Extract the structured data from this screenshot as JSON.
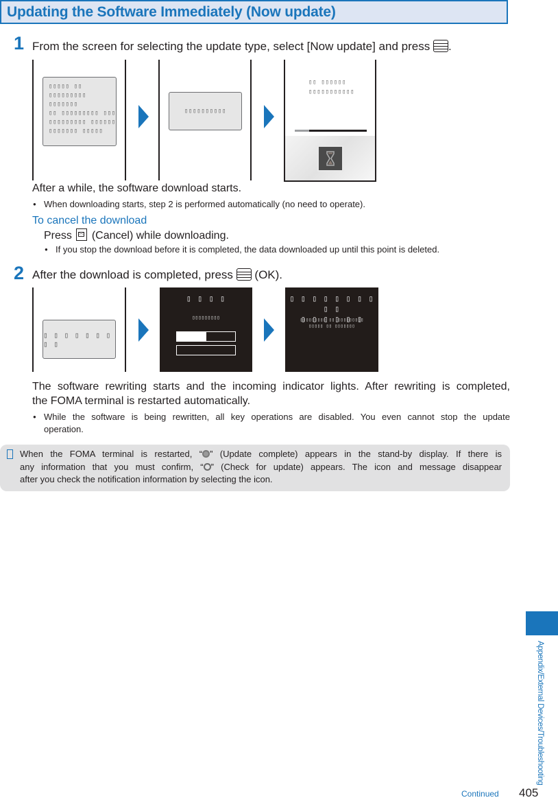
{
  "header": {
    "title": "Updating the Software Immediately (Now update)"
  },
  "step1": {
    "number": "1",
    "text_before": "From the screen for selecting the update type, select [Now update] and press",
    "text_after": ".",
    "key_icon": "menu-key-icon",
    "screens": [
      {
        "type": "dialog",
        "lines": [
          "▯▯▯▯▯ ▯▯",
          "▯▯▯▯▯▯▯▯▯",
          "▯▯▯▯▯▯▯",
          "▯▯ ▯▯▯▯▯▯▯▯▯ ▯▯▯",
          "▯▯▯▯▯▯▯▯▯ ▯▯▯▯▯▯",
          "▯▯▯▯▯▯▯ ▯▯▯▯▯"
        ]
      },
      {
        "type": "dialog",
        "lines": [
          "▯▯▯▯▯▯▯▯▯▯"
        ]
      },
      {
        "type": "download",
        "lines": [
          "▯▯ ▯▯▯▯▯▯",
          "▯▯▯▯▯▯▯▯▯▯▯"
        ],
        "progress": 0.2,
        "icon": "hourglass-icon"
      }
    ],
    "result": "After a while, the software download starts.",
    "bullet": "When downloading starts, step 2 is performed automatically (no need to operate).",
    "cancel": {
      "heading": "To cancel the download",
      "press_before": "Press",
      "press_after": "(Cancel) while downloading.",
      "key_icon": "mail-key-icon",
      "bullet": "If you stop the download before it is completed, the data downloaded up until this point is deleted."
    }
  },
  "step2": {
    "number": "2",
    "text_before": "After the download is completed, press",
    "text_after": "(OK).",
    "key_icon": "menu-key-icon",
    "screens": [
      {
        "type": "dialog",
        "lines": [
          "▯ ▯ ▯ ▯ ▯ ▯ ▯ ▯ ▯"
        ]
      },
      {
        "type": "dark-progress",
        "title": "▯ ▯ ▯ ▯",
        "subtitle": "▯▯▯▯▯▯▯▯▯",
        "progress": 0.5
      },
      {
        "type": "dark-message",
        "title_lines": [
          "▯ ▯ ▯ ▯ ▯ ▯ ▯ ▯ ▯ ▯",
          "▯ ▯ ▯ ▯ ▯ ▯"
        ],
        "lines": [
          "▯▯▯▯▯▯▯▯▯ ▯▯ ▯▯▯▯▯▯▯▯▯",
          "▯▯▯▯▯ ▯▯ ▯▯▯▯▯▯▯"
        ]
      }
    ],
    "result_line1": "The software rewriting starts and the incoming indicator lights. After rewriting is completed,",
    "result_line2": "the FOMA terminal is restarted automatically.",
    "bullet_line1": "While the software is being rewritten, all key operations are disabled. You even cannot stop the update",
    "bullet_line2": "operation."
  },
  "note": {
    "line1_a": "When the FOMA terminal is restarted, “",
    "line1_b": "” (Update complete) appears in the stand-by display. If there is",
    "line2_a": "any information that you must confirm, “",
    "line2_b": "” (Check for update) appears. The icon and message disappear",
    "line3": "after you check the notification information by selecting the icon.",
    "icons": [
      "update-complete-icon",
      "check-for-update-icon"
    ]
  },
  "sidebar": {
    "section": "Appendix/External Devices/Troubleshooting"
  },
  "footer": {
    "continued": "Continued",
    "page_number": "405"
  },
  "colors": {
    "accent": "#1a75bb",
    "header_bg": "#dde5f3",
    "note_bg": "#e1e1e2",
    "dark_screen": "#221c1a"
  }
}
